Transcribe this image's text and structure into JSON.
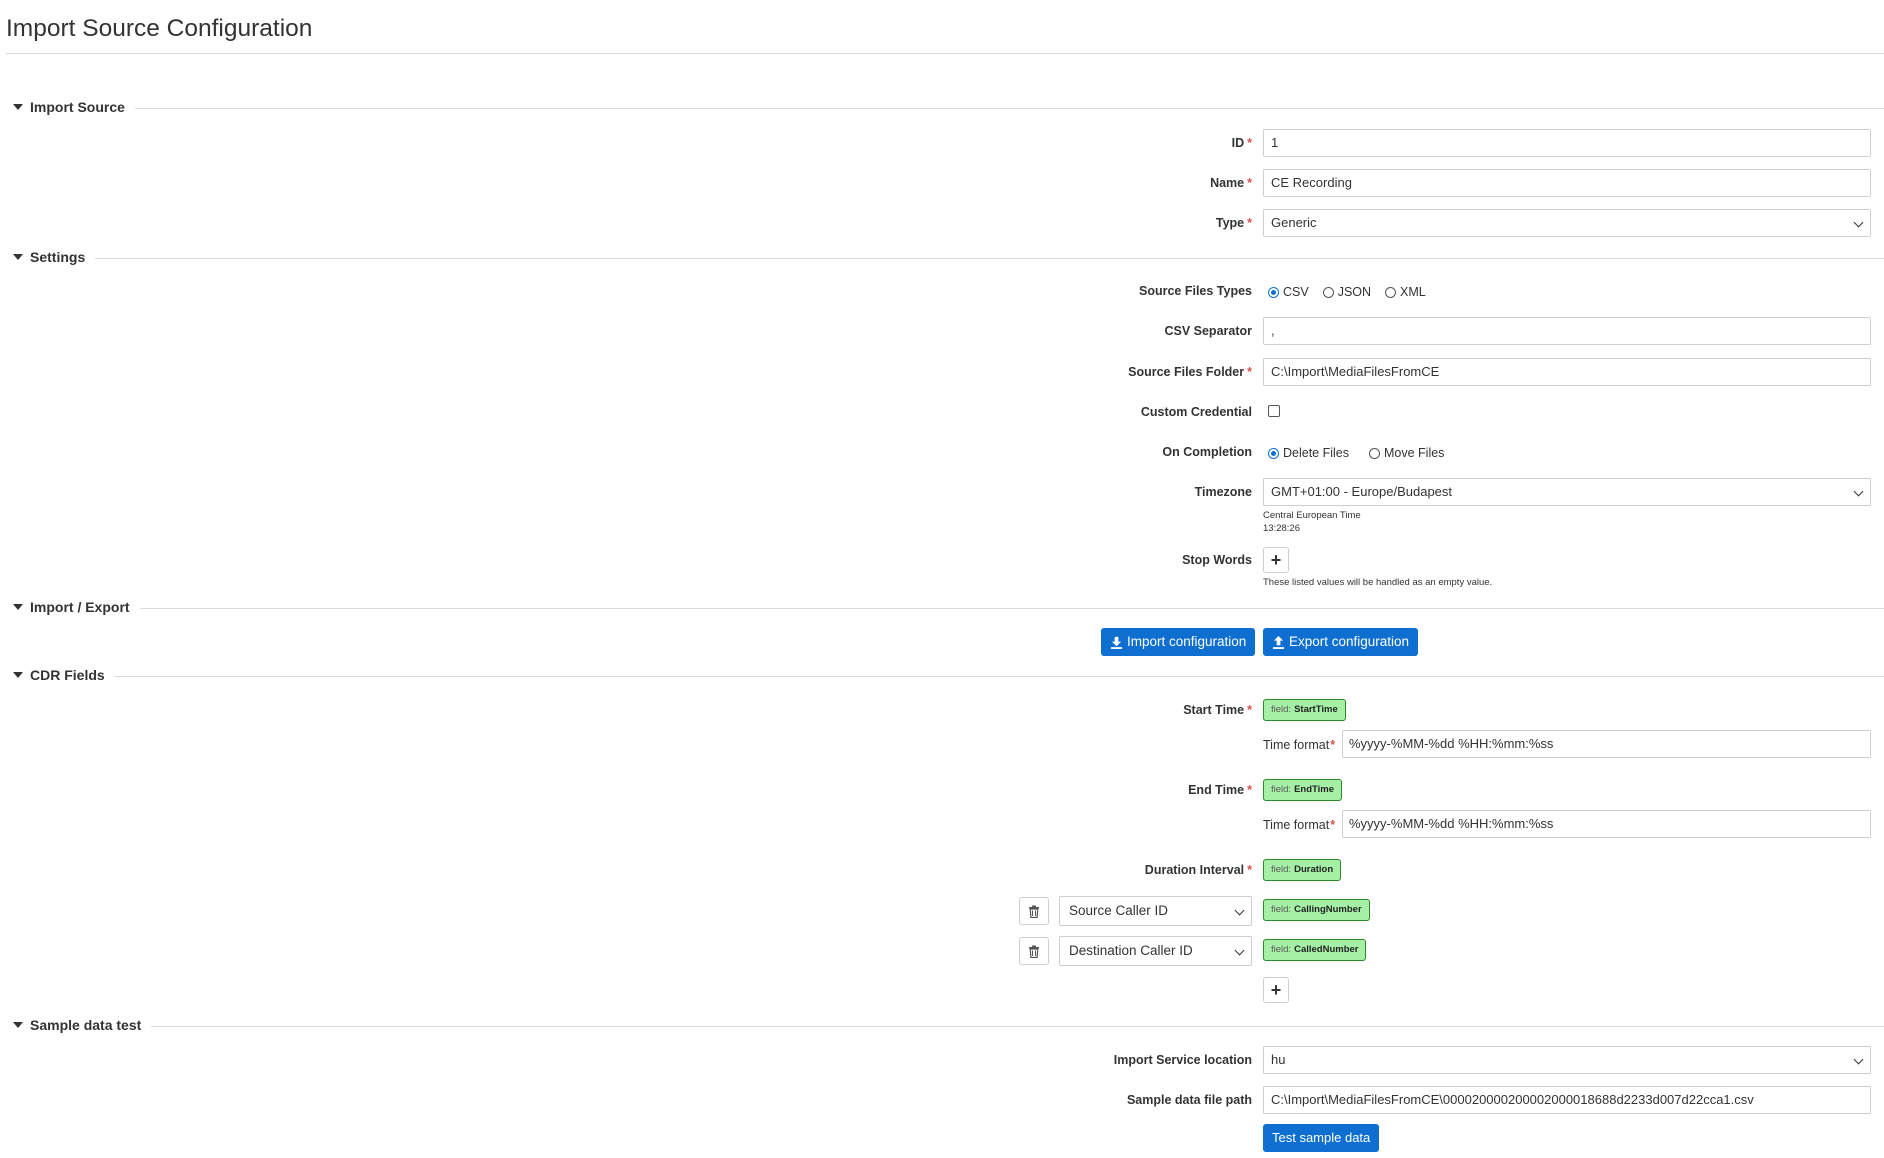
{
  "page": {
    "title": "Import Source Configuration"
  },
  "sections": {
    "import_source": "Import Source",
    "settings": "Settings",
    "import_export": "Import / Export",
    "cdr_fields": "CDR Fields",
    "sample_data_test": "Sample data test"
  },
  "import_source": {
    "id_label": "ID",
    "id_value": "1",
    "name_label": "Name",
    "name_value": "CE Recording",
    "type_label": "Type",
    "type_value": "Generic"
  },
  "settings": {
    "source_files_types_label": "Source Files Types",
    "file_types": [
      "CSV",
      "JSON",
      "XML"
    ],
    "file_type_selected": "CSV",
    "csv_separator_label": "CSV Separator",
    "csv_separator_value": ",",
    "source_files_folder_label": "Source Files Folder",
    "source_files_folder_value": "C:\\Import\\MediaFilesFromCE",
    "custom_credential_label": "Custom Credential",
    "custom_credential_checked": false,
    "on_completion_label": "On Completion",
    "on_completion_options": [
      "Delete Files",
      "Move Files"
    ],
    "on_completion_selected": "Delete Files",
    "timezone_label": "Timezone",
    "timezone_value": "GMT+01:00 - Europe/Budapest",
    "timezone_name": "Central European Time",
    "timezone_time": "13:28:26",
    "stop_words_label": "Stop Words",
    "stop_words_hint": "These listed values will be handled as an empty value."
  },
  "import_export": {
    "import_button": "Import configuration",
    "export_button": "Export configuration"
  },
  "cdr_fields": {
    "field_prefix": "field:",
    "start_time_label": "Start Time",
    "start_time_field": "StartTime",
    "time_format_label": "Time format",
    "start_time_format": "%yyyy-%MM-%dd %HH:%mm:%ss",
    "end_time_label": "End Time",
    "end_time_field": "EndTime",
    "end_time_format": "%yyyy-%MM-%dd %HH:%mm:%ss",
    "duration_label": "Duration Interval",
    "duration_field": "Duration",
    "mapping_rows": [
      {
        "select": "Source Caller ID",
        "field": "CallingNumber"
      },
      {
        "select": "Destination Caller ID",
        "field": "CalledNumber"
      }
    ]
  },
  "sample_data": {
    "service_location_label": "Import Service location",
    "service_location_value": "hu",
    "file_path_label": "Sample data file path",
    "file_path_value": "C:\\Import\\MediaFilesFromCE\\000020000200002000018688d2233d007d22cca1.csv",
    "test_button": "Test sample data"
  },
  "colors": {
    "primary": "#0f6fd1",
    "field_tag_bg": "#a6f0a6",
    "field_tag_border": "#2d8a2d",
    "required": "#d9534f"
  }
}
